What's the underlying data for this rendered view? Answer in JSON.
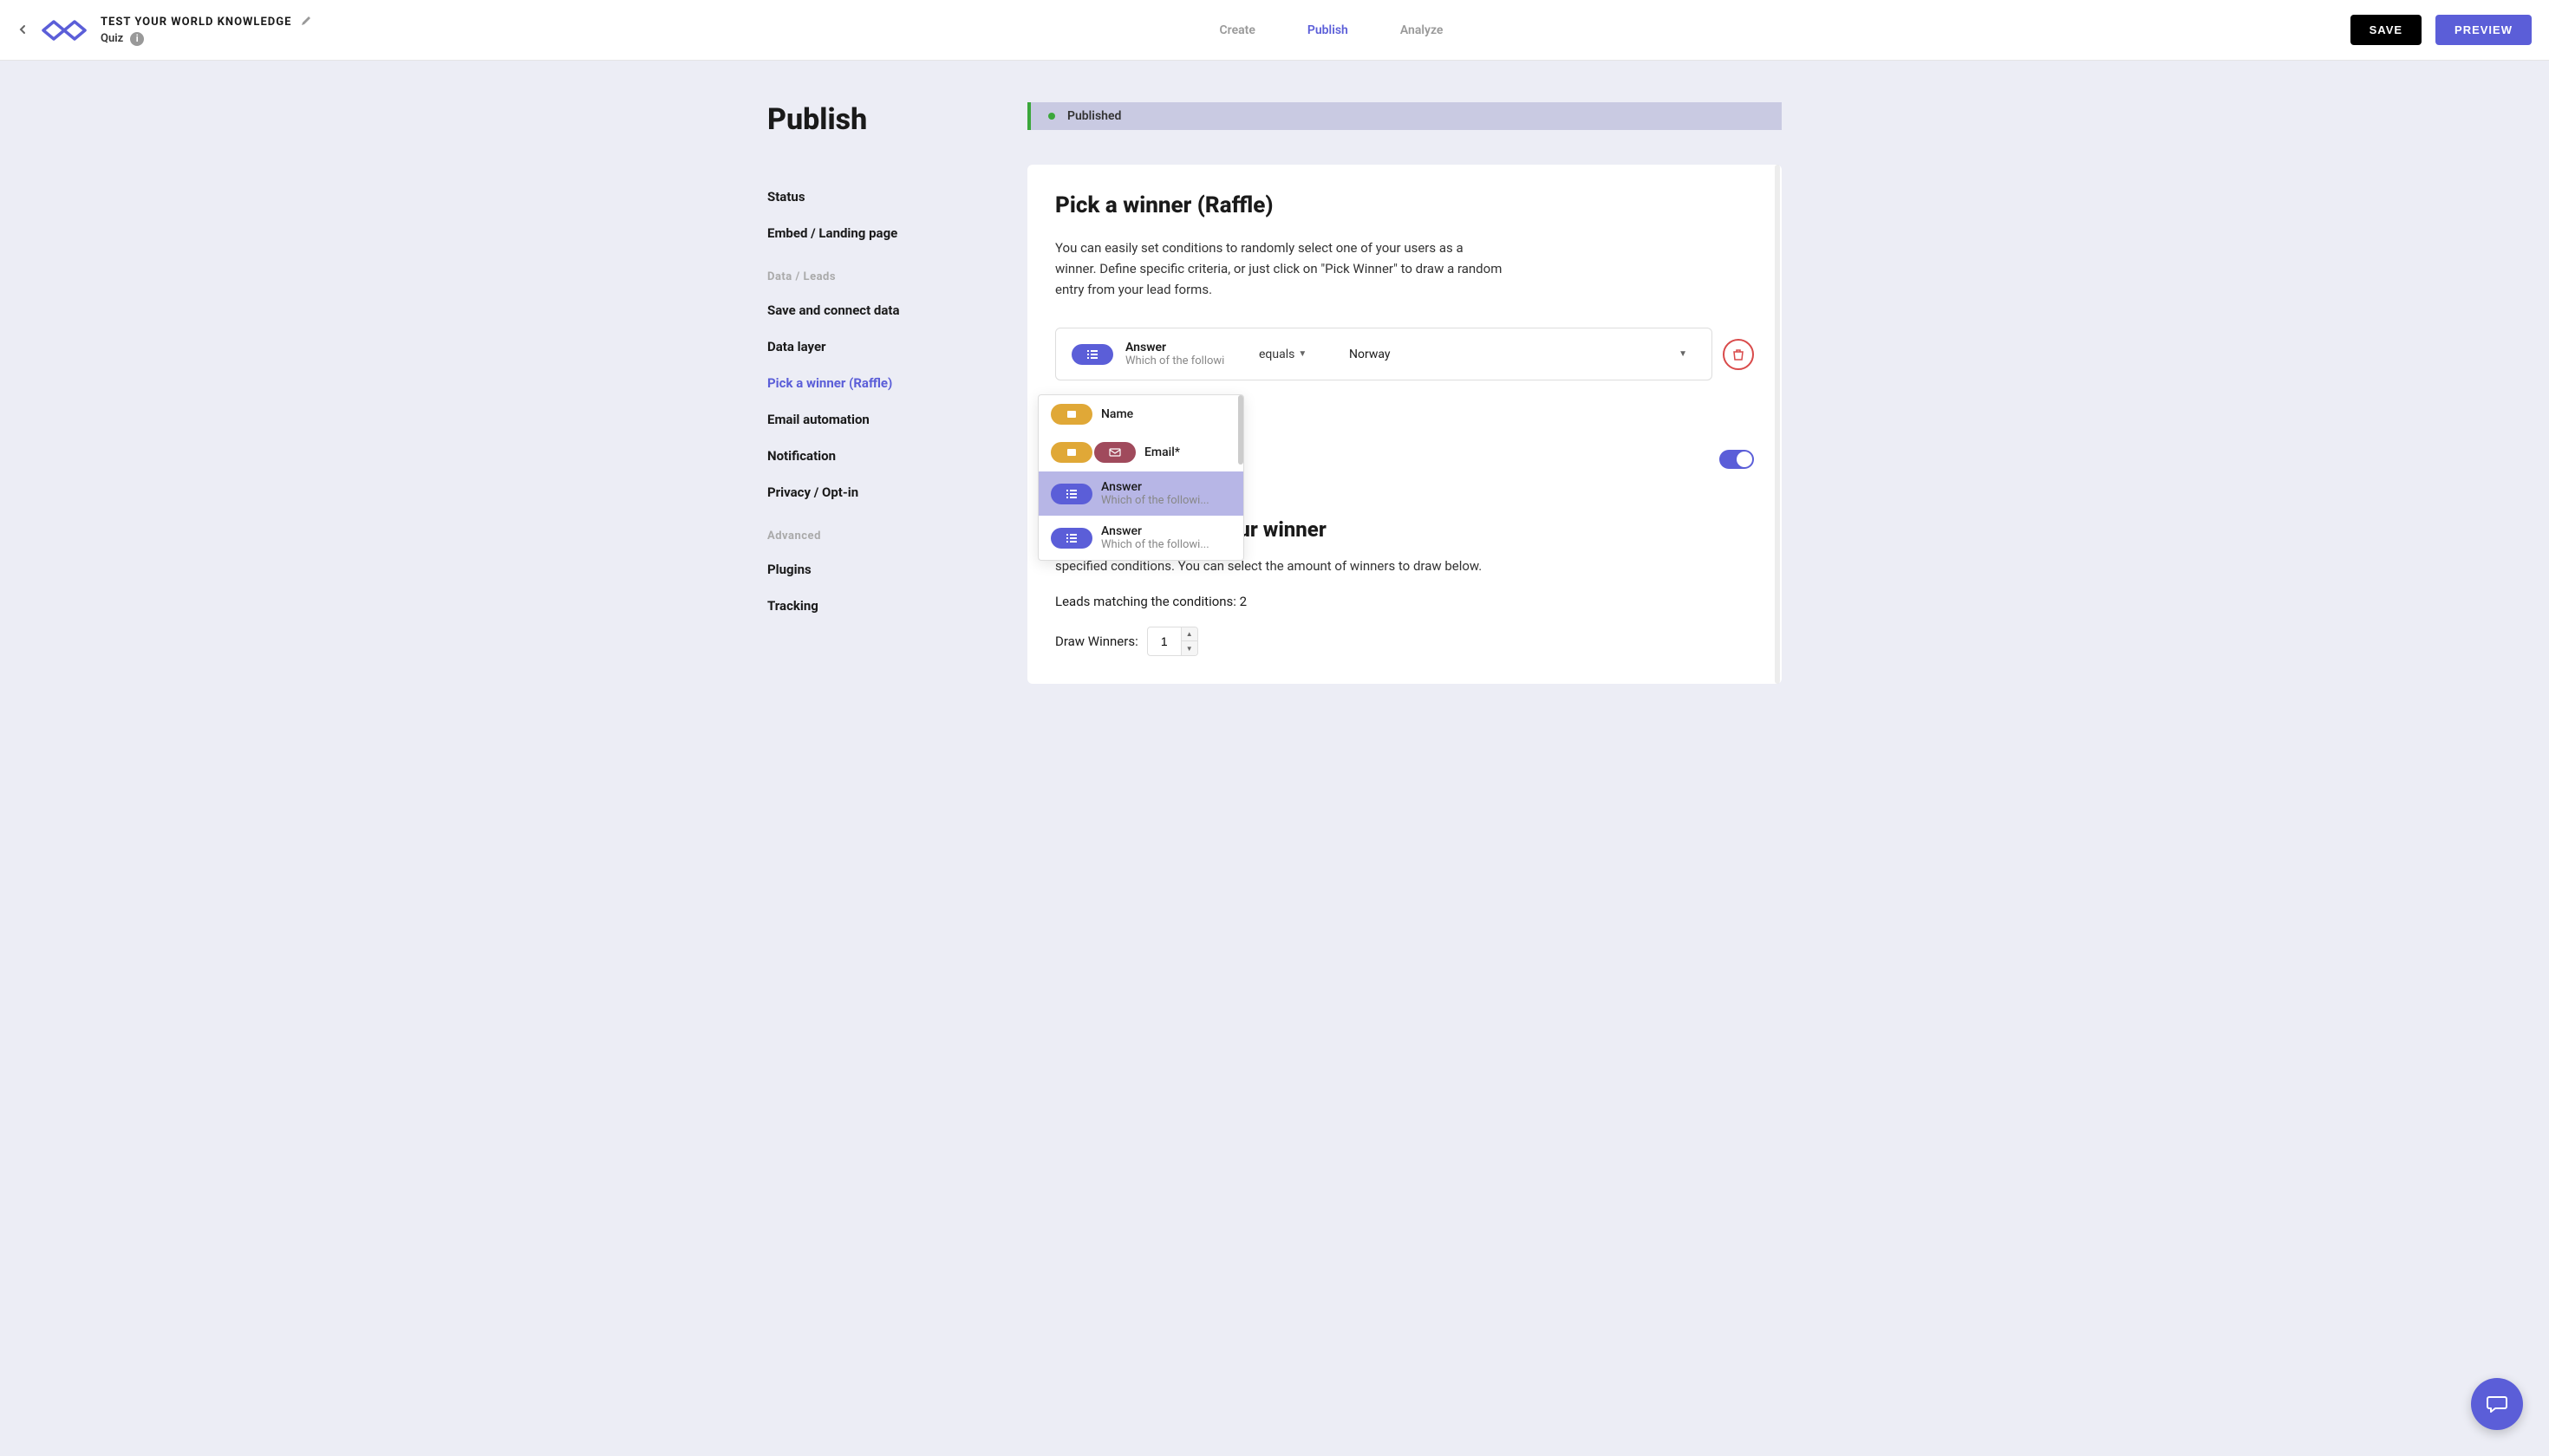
{
  "header": {
    "project_title": "TEST YOUR WORLD KNOWLEDGE",
    "subtitle": "Quiz",
    "tabs": {
      "create": "Create",
      "publish": "Publish",
      "analyze": "Analyze"
    },
    "save": "SAVE",
    "preview": "PREVIEW"
  },
  "sidebar": {
    "heading": "Publish",
    "group1": [
      {
        "label": "Status"
      },
      {
        "label": "Embed / Landing page"
      }
    ],
    "group2_title": "Data / Leads",
    "group2": [
      {
        "label": "Save and connect data"
      },
      {
        "label": "Data layer"
      },
      {
        "label": "Pick a winner (Raffle)",
        "active": true
      },
      {
        "label": "Email automation"
      },
      {
        "label": "Notification"
      },
      {
        "label": "Privacy / Opt-in"
      }
    ],
    "group3_title": "Advanced",
    "group3": [
      {
        "label": "Plugins"
      },
      {
        "label": "Tracking"
      }
    ]
  },
  "status_bar": {
    "text": "Published"
  },
  "card": {
    "title": "Pick a winner (Raffle)",
    "description": "You can easily set conditions to randomly select one of your users as a winner. Define specific criteria, or just click on \"Pick Winner\" to draw a random entry from your lead forms.",
    "condition": {
      "field_label": "Answer",
      "field_sub": "Which of the followi",
      "operator": "equals",
      "value": "Norway"
    },
    "dropdown": {
      "items": [
        {
          "type": "lead",
          "label": "Name"
        },
        {
          "type": "lead-email",
          "label": "Email*"
        },
        {
          "type": "answer",
          "label": "Answer",
          "sub": "Which of the followi...",
          "highlighted": true
        },
        {
          "type": "answer",
          "label": "Answer",
          "sub": "Which of the followi..."
        }
      ]
    },
    "randomly_title": "Randomly select your winner",
    "randomly_desc": "specified conditions. You can select the amount of winners to draw below.",
    "leads_match": "Leads matching the conditions: 2",
    "draw_label": "Draw Winners:",
    "draw_value": "1"
  }
}
